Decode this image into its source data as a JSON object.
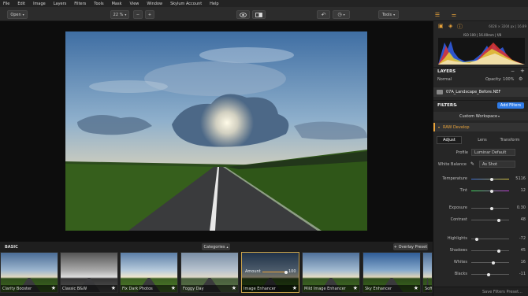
{
  "menu": [
    "File",
    "Edit",
    "Image",
    "Layers",
    "Filters",
    "Tools",
    "Mask",
    "View",
    "Window",
    "Skylum Account",
    "Help"
  ],
  "toolbar": {
    "open_label": "Open",
    "zoom_label": "22 %",
    "zoom_out": "−",
    "zoom_in": "+",
    "tools_label": "Tools"
  },
  "panel": {
    "image_info": "6028 × 3204 px | 16.89",
    "exif": "ISO 100 | 16.00mm | f/8",
    "layers_title": "LAYERS",
    "blend_mode": "Normal",
    "opacity_label": "Opacity: 100%",
    "layer_name": "07A_Landscape_Before.NEF",
    "filters_title": "FILTERS",
    "add_filters": "Add Filters",
    "workspace": "Custom Workspace",
    "raw_develop": "RAW Develop",
    "tabs": [
      "Adjust",
      "Lens",
      "Transform"
    ],
    "profile_label": "Profile",
    "profile_value": "Luminar Default",
    "wb_label": "White Balance",
    "wb_value": "As Shot",
    "sliders": [
      {
        "label": "Temperature",
        "value": "5116",
        "pos": 0.55,
        "color": "temp"
      },
      {
        "label": "Tint",
        "value": "12",
        "pos": 0.55,
        "color": "tint"
      },
      {
        "label": "Exposure",
        "value": "0.30",
        "pos": 0.55,
        "color": "plain"
      },
      {
        "label": "Contrast",
        "value": "48",
        "pos": 0.72,
        "color": "plain"
      },
      {
        "label": "Highlights",
        "value": "-72",
        "pos": 0.14,
        "color": "plain"
      },
      {
        "label": "Shadows",
        "value": "45",
        "pos": 0.72,
        "color": "plain"
      },
      {
        "label": "Whites",
        "value": "16",
        "pos": 0.58,
        "color": "plain"
      },
      {
        "label": "Blacks",
        "value": "-11",
        "pos": 0.45,
        "color": "plain"
      }
    ],
    "save_preset": "Save Filters Preset..."
  },
  "strip": {
    "category": "BASIC",
    "categories_btn": "Categories",
    "overlay_btn": "+ Overlay Preset",
    "amount_label": "Amount",
    "amount_value": "100",
    "amount_fraction": 1.0,
    "thumbs": [
      "Clarity Booster",
      "Classic B&W",
      "Fix Dark Photos",
      "Foggy Day",
      "Image Enhancer",
      "Mild Image Enhancer",
      "Sky Enhancer",
      "Soft"
    ]
  },
  "colors": {
    "accent": "#2f7be6",
    "selected_border": "#c9a24a",
    "raw_header": "#e8a33b"
  }
}
